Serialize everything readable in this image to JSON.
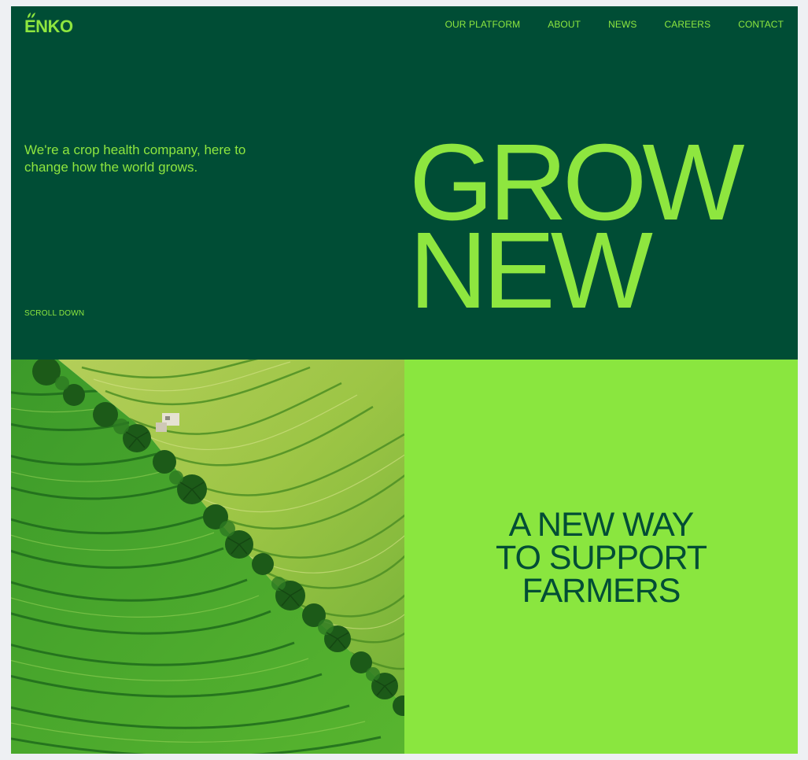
{
  "brand": {
    "logo_text": "ENKO",
    "accent_color": "#8ee63f",
    "dark_green": "#004d35",
    "light_green": "#8ae63f"
  },
  "nav": {
    "items": [
      {
        "label": "OUR PLATFORM"
      },
      {
        "label": "ABOUT"
      },
      {
        "label": "NEWS"
      },
      {
        "label": "CAREERS"
      },
      {
        "label": "CONTACT"
      }
    ]
  },
  "hero": {
    "tagline": "We're a crop health company, here to change how the world grows.",
    "scroll_label": "SCROLL DOWN",
    "headline_line1": "GROW",
    "headline_line2": "NEW"
  },
  "feature": {
    "image_icon": "rice-terrace-aerial-photo",
    "line1": "A NEW WAY",
    "line2": "TO SUPPORT",
    "line3": "FARMERS"
  }
}
